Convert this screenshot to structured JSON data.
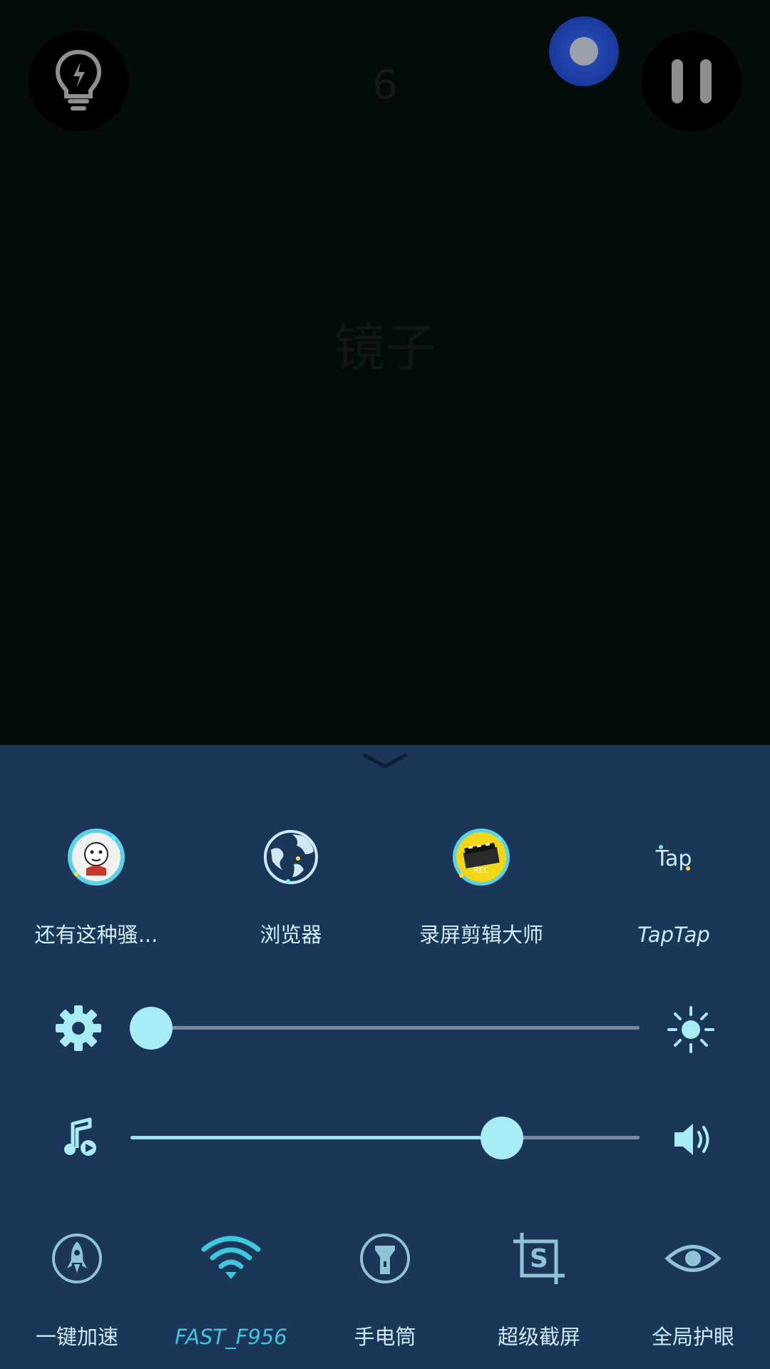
{
  "camera": {
    "counter": "6",
    "mirror_label": "镜子",
    "icons": {
      "bulb": "bulb-flash-icon",
      "record": "record-icon",
      "pause": "pause-icon"
    }
  },
  "panel": {
    "apps": [
      {
        "label": "还有这种骚...",
        "icon": "meme-face-icon"
      },
      {
        "label": "浏览器",
        "icon": "globe-icon"
      },
      {
        "label": "录屏剪辑大师",
        "icon": "rec-clapper-icon"
      },
      {
        "label": "TapTap",
        "icon": "taptap-icon"
      }
    ],
    "brightness": {
      "level": 0.04,
      "left_icon": "gear-icon",
      "right_icon": "sun-icon"
    },
    "volume": {
      "level": 0.73,
      "left_icon": "music-note-icon",
      "right_icon": "speaker-icon"
    },
    "tiles": [
      {
        "label": "一键加速",
        "icon": "rocket-icon"
      },
      {
        "label": "FAST_F956",
        "icon": "wifi-icon"
      },
      {
        "label": "手电筒",
        "icon": "flashlight-icon"
      },
      {
        "label": "超级截屏",
        "icon": "screenshot-icon"
      },
      {
        "label": "全局护眼",
        "icon": "eye-icon"
      }
    ],
    "colors": {
      "panel_bg": "#1b3659",
      "accent": "#9ae4ef",
      "wifi": "#3ec7dd"
    }
  }
}
